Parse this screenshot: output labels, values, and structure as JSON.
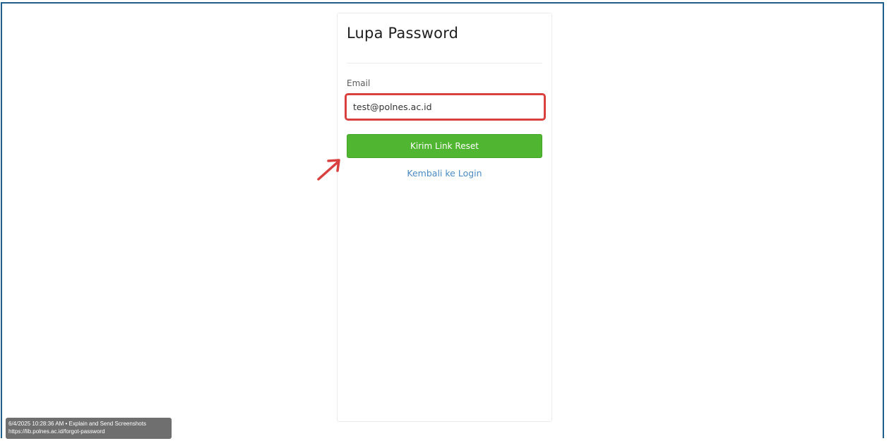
{
  "card": {
    "title": "Lupa Password",
    "email_label": "Email",
    "email_value": "test@polnes.ac.id",
    "submit_label": "Kirim Link Reset",
    "back_link": "Kembali ke Login"
  },
  "annotations": {
    "highlight_color": "#d8413f",
    "arrow_color": "#d8413f",
    "arrow_icon": "arrow-up-right-icon"
  },
  "capture_info": {
    "line1": "6/4/2025 10:28:36 AM • Explain and Send Screenshots",
    "line2": "https://lib.polnes.ac.id/forgot-password"
  },
  "colors": {
    "frame_border": "#1f5f8b",
    "button": "#50b531",
    "link": "#4a8ac2"
  }
}
